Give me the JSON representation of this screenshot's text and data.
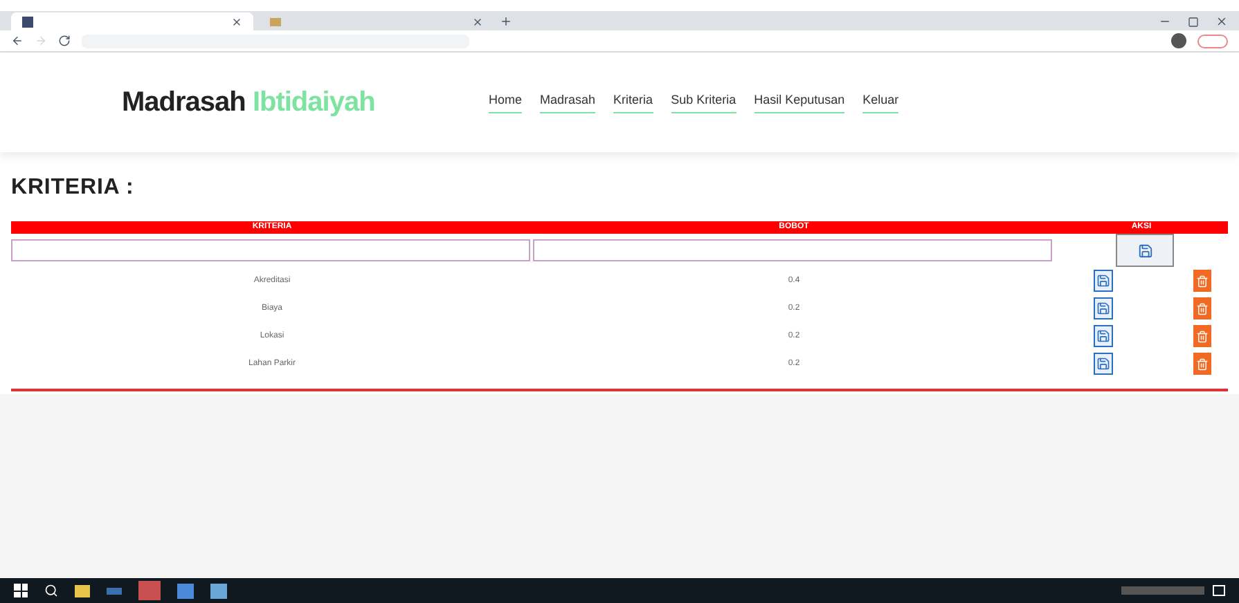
{
  "brand": {
    "first": "Madrasah",
    "second": "Ibtidaiyah"
  },
  "nav": [
    "Home",
    "Madrasah",
    "Kriteria",
    "Sub Kriteria",
    "Hasil Keputusan",
    "Keluar"
  ],
  "heading": "KRITERIA :",
  "table": {
    "columns": [
      "KRITERIA",
      "BOBOT",
      "AKSI"
    ],
    "rows": [
      {
        "name": "Akreditasi",
        "weight": "0.4"
      },
      {
        "name": "Biaya",
        "weight": "0.2"
      },
      {
        "name": "Lokasi",
        "weight": "0.2"
      },
      {
        "name": "Lahan Parkir",
        "weight": "0.2"
      }
    ]
  }
}
